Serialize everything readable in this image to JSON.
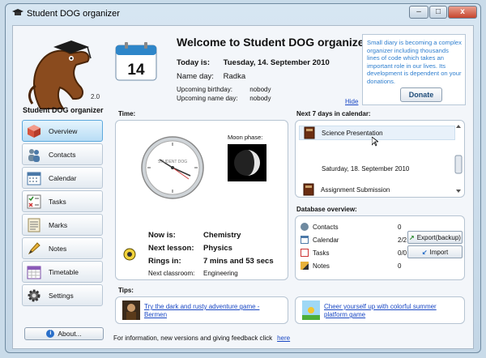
{
  "window": {
    "title": "Student DOG organizer",
    "minimize": "–",
    "maximize": "□",
    "close": "x"
  },
  "sidebar": {
    "version": "2.0",
    "title": "Student DOG organizer",
    "items": [
      {
        "label": "Overview",
        "icon": "cube-icon",
        "active": true
      },
      {
        "label": "Contacts",
        "icon": "contacts-icon"
      },
      {
        "label": "Calendar",
        "icon": "calendar-icon"
      },
      {
        "label": "Tasks",
        "icon": "tasks-icon"
      },
      {
        "label": "Marks",
        "icon": "marks-icon"
      },
      {
        "label": "Notes",
        "icon": "pencil-icon"
      },
      {
        "label": "Timetable",
        "icon": "timetable-icon"
      },
      {
        "label": "Settings",
        "icon": "gear-icon"
      }
    ],
    "about_label": "About..."
  },
  "header": {
    "calendar_day": "14",
    "welcome": "Welcome to Student DOG organizer!",
    "today_label": "Today is:",
    "today_value": "Tuesday, 14. September 2010",
    "nameday_label": "Name day:",
    "nameday_value": "Radka",
    "birthday_label": "Upcoming birthday:",
    "birthday_value": "nobody",
    "upnameday_label": "Upcoming name day:",
    "upnameday_value": "nobody",
    "hide_link": "Hide"
  },
  "donate": {
    "text": "Small diary is becoming a complex organizer including thousands lines of code which takes an important role in our lives. Its development is dependent on your donations.",
    "button": "Donate"
  },
  "time": {
    "section": "Time:",
    "clock_brand": "STUDENT DOG",
    "moon_label": "Moon phase:",
    "now_label": "Now is:",
    "now_value": "Chemistry",
    "next_label": "Next lesson:",
    "next_value": "Physics",
    "rings_label": "Rings in:",
    "rings_value": "7 mins and 53 secs",
    "classroom_label": "Next classroom:",
    "classroom_value": "Engineering"
  },
  "next7": {
    "section": "Next 7 days in calendar:",
    "event1": "Science Presentation",
    "date": "Saturday, 18. September 2010",
    "event2": "Assignment Submission"
  },
  "database": {
    "section": "Database overview:",
    "rows": [
      {
        "label": "Contacts",
        "value": "0"
      },
      {
        "label": "Calendar",
        "value": "2/2"
      },
      {
        "label": "Tasks",
        "value": "0/0"
      },
      {
        "label": "Notes",
        "value": "0"
      }
    ],
    "export_label": "Export(backup)",
    "import_label": "Import"
  },
  "tips": {
    "section": "Tips:",
    "tip1": "Try the dark and rusty adventure game - Bermen",
    "tip2": "Cheer yourself up with colorful summer platform game"
  },
  "footer": {
    "text": "For information, new versions and giving feedback click",
    "link": "here"
  },
  "colors": {
    "accent": "#5da9dd",
    "link": "#1a48c4",
    "donate_text": "#2f7fcf"
  }
}
